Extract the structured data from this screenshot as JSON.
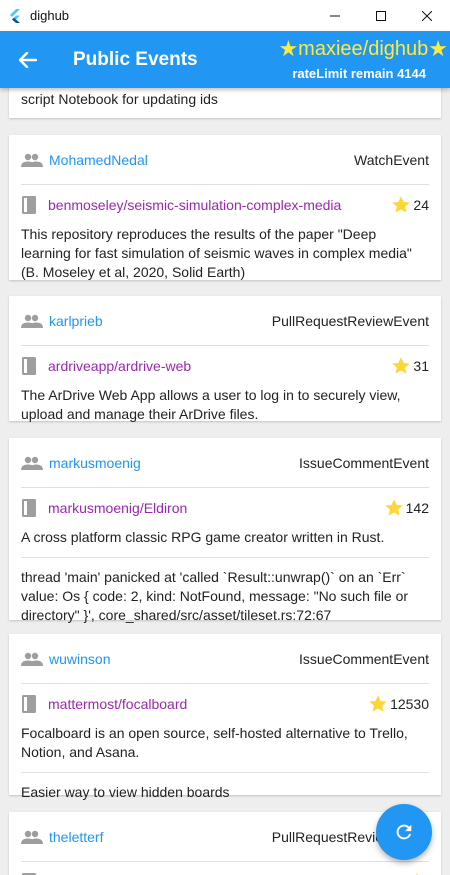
{
  "window": {
    "title": "dighub"
  },
  "appbar": {
    "title": "Public Events",
    "account": "maxiee/dighub",
    "rate_limit": "rateLimit remain 4144"
  },
  "colors": {
    "primary": "#2196f3",
    "user": "#2196f3",
    "repo": "#9c27b0",
    "star": "#fdd835"
  },
  "partial_top_text": "script Notebook for updating ids",
  "events": [
    {
      "user": "MohamedNedal",
      "type": "WatchEvent",
      "repo": "benmoseley/seismic-simulation-complex-media",
      "stars": "24",
      "description": "This repository reproduces the results of the paper \"Deep learning for fast simulation of seismic waves in complex media\" (B. Moseley et al, 2020, Solid Earth)"
    },
    {
      "user": "karlprieb",
      "type": "PullRequestReviewEvent",
      "repo": "ardriveapp/ardrive-web",
      "stars": "31",
      "description": "The ArDrive Web App allows a user to log in to securely view, upload and manage their ArDrive files."
    },
    {
      "user": "markusmoenig",
      "type": "IssueCommentEvent",
      "repo": "markusmoenig/Eldiron",
      "stars": "142",
      "description": "A cross platform classic RPG game creator written in Rust.",
      "extra": "thread 'main' panicked at 'called `Result::unwrap()` on an `Err` value: Os { code: 2, kind: NotFound, message: \"No such file or directory\" }', core_shared/src/asset/tileset.rs:72:67"
    },
    {
      "user": "wuwinson",
      "type": "IssueCommentEvent",
      "repo": "mattermost/focalboard",
      "stars": "12530",
      "description": "Focalboard is an open source, self-hosted alternative to Trello, Notion, and Asana.",
      "extra": "Easier way to view hidden boards"
    },
    {
      "user": "theletterf",
      "type": "PullRequestReviewEvent",
      "repo": "",
      "stars": ""
    }
  ]
}
